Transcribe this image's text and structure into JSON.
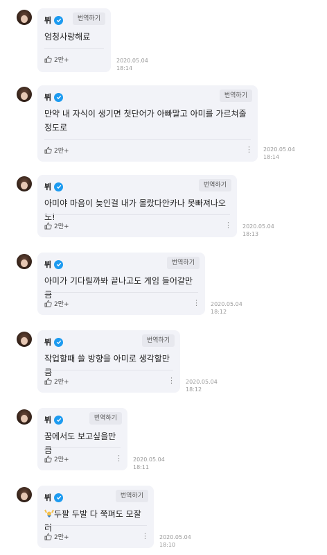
{
  "translate_label": "번역하기",
  "messages": [
    {
      "author": "뷔",
      "text": "엄청사랑해료",
      "likes": "2만+",
      "date": "2020.05.04",
      "time": "18:14"
    },
    {
      "author": "뷔",
      "text": "만약 내 자식이 생기면 첫단어가 아빠말고 아미를 가르쳐줄 정도로",
      "likes": "2만+",
      "date": "2020.05.04",
      "time": "18:14"
    },
    {
      "author": "뷔",
      "text": "아미야 마음이 늦인걸 내가 몰랐다안카나 못빠져나오노!",
      "likes": "2만+",
      "date": "2020.05.04",
      "time": "18:13"
    },
    {
      "author": "뷔",
      "text": "아미가 기다릴까봐 끝나고도 게임 들어갈만큼",
      "likes": "2만+",
      "date": "2020.05.04",
      "time": "18:12"
    },
    {
      "author": "뷔",
      "text": "작업할때 쓸 방향을 아미로 생각할만큼",
      "likes": "2만+",
      "date": "2020.05.04",
      "time": "18:12"
    },
    {
      "author": "뷔",
      "text": "꿈에서도 보고싶을만큼",
      "likes": "2만+",
      "date": "2020.05.04",
      "time": "18:11"
    },
    {
      "author": "뷔",
      "text": "두팔 두발 다 쭉펴도 모잘러",
      "emoji": "raising-hands-emoji",
      "likes": "2만+",
      "date": "2020.05.04",
      "time": "18:10"
    }
  ]
}
